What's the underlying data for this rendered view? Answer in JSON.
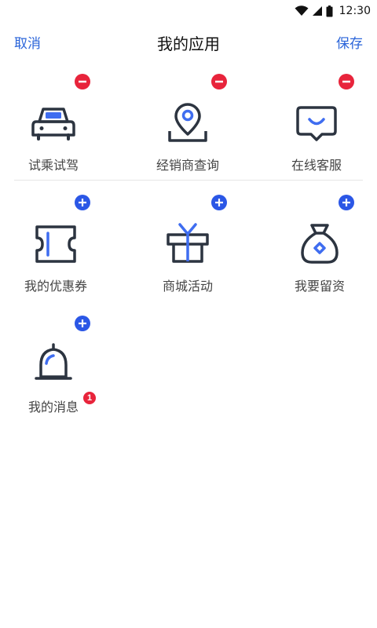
{
  "status_bar": {
    "time": "12:30"
  },
  "nav": {
    "cancel_label": "取消",
    "title": "我的应用",
    "save_label": "保存"
  },
  "my_apps": [
    {
      "label": "试乘试驾",
      "icon": "car-icon"
    },
    {
      "label": "经销商查询",
      "icon": "location-pin-icon"
    },
    {
      "label": "在线客服",
      "icon": "chat-smile-icon"
    }
  ],
  "more_apps": [
    {
      "label": "我的优惠券",
      "icon": "coupon-icon"
    },
    {
      "label": "商城活动",
      "icon": "gift-icon"
    },
    {
      "label": "我要留资",
      "icon": "money-bag-icon"
    },
    {
      "label": "我的消息",
      "icon": "bell-icon",
      "badge_count": "1"
    }
  ],
  "colors": {
    "accent": "#2a64d9",
    "icon_accent": "#3f6df0",
    "remove": "#e8243b",
    "add": "#2b57e6",
    "icon_stroke": "#2c3440"
  }
}
